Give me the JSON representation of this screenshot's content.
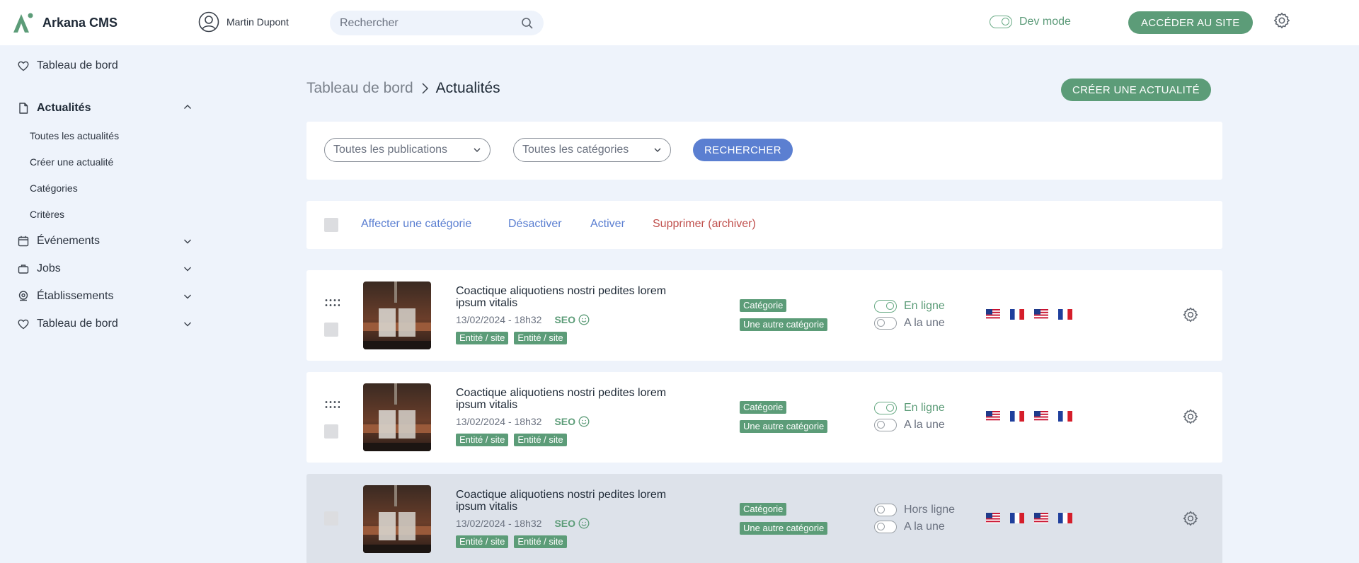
{
  "app": {
    "title": "Arkana CMS"
  },
  "header": {
    "user_name": "Martin Dupont",
    "search_placeholder": "Rechercher",
    "dev_mode_label": "Dev mode",
    "site_button": "ACCÉDER AU SITE"
  },
  "sidebar": {
    "items": [
      {
        "label": "Tableau de bord",
        "icon": "heart-icon"
      },
      {
        "label": "Actualités",
        "icon": "document-icon",
        "expanded": true
      },
      {
        "label": "Événements",
        "icon": "calendar-icon"
      },
      {
        "label": "Jobs",
        "icon": "jobs-icon"
      },
      {
        "label": "Établissements",
        "icon": "location-icon"
      },
      {
        "label": "Tableau de bord",
        "icon": "heart-icon"
      }
    ],
    "subitems": [
      "Toutes les actualités",
      "Créer une actualité",
      "Catégories",
      "Critères"
    ]
  },
  "breadcrumb": {
    "home": "Tableau de bord",
    "current": "Actualités"
  },
  "create_button": "CRÉER UNE ACTUALITÉ",
  "filters": {
    "publications": "Toutes les publications",
    "categories": "Toutes les catégories",
    "search_button": "RECHERCHER"
  },
  "bulk_actions": [
    "Affecter une catégorie",
    "Désactiver",
    "Activer",
    "Supprimer (archiver)"
  ],
  "colors": {
    "accent_green": "#5c9c78",
    "accent_blue": "#5b7fd1",
    "danger": "#c0504d",
    "background": "#eef3fb"
  },
  "articles": [
    {
      "title": "Coactique aliquotiens nostri pedites lorem ipsum vitalis",
      "date": "13/02/2024 - 18h32",
      "seo": "SEO",
      "tags": [
        "Entité / site",
        "Entité / site"
      ],
      "categories": [
        "Catégorie",
        "Une autre catégorie"
      ],
      "status": "En ligne",
      "featured": "A la une",
      "online": true,
      "selected": false
    },
    {
      "title": "Coactique aliquotiens nostri pedites lorem ipsum vitalis",
      "date": "13/02/2024 - 18h32",
      "seo": "SEO",
      "tags": [
        "Entité / site",
        "Entité / site"
      ],
      "categories": [
        "Catégorie",
        "Une autre catégorie"
      ],
      "status": "En ligne",
      "featured": "A la une",
      "online": true,
      "selected": false
    },
    {
      "title": "Coactique aliquotiens nostri pedites lorem ipsum vitalis",
      "date": "13/02/2024 - 18h32",
      "seo": "SEO",
      "tags": [
        "Entité / site",
        "Entité / site"
      ],
      "categories": [
        "Catégorie",
        "Une autre catégorie"
      ],
      "status": "Hors ligne",
      "featured": "A la une",
      "online": false,
      "selected": true
    }
  ]
}
